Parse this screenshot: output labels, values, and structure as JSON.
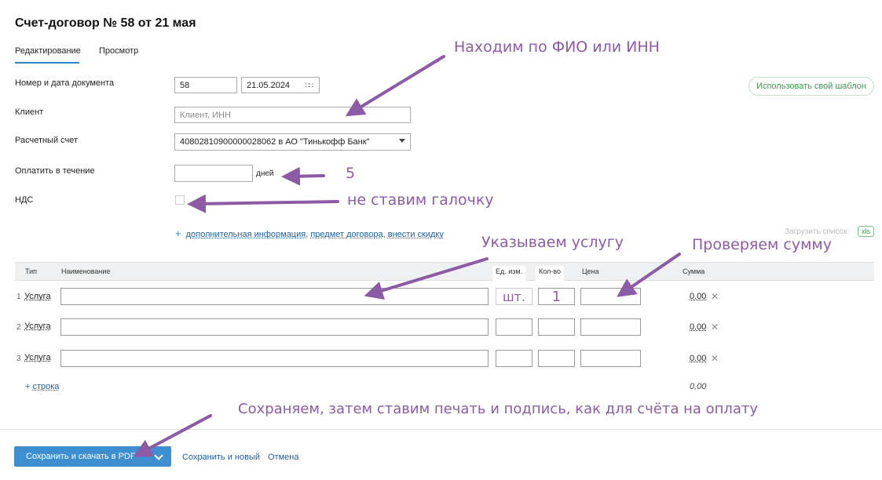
{
  "page": {
    "title": "Счет-договор № 58 от 21 мая",
    "tabs": [
      {
        "label": "Редактирование",
        "active": true
      },
      {
        "label": "Просмотр",
        "active": false
      }
    ]
  },
  "form": {
    "doc_number_label": "Номер и дата документа",
    "doc_number": "58",
    "doc_date": "21.05.2024",
    "client_label": "Клиент",
    "client_placeholder": "Клиент, ИНН",
    "account_label": "Расчетный счет",
    "account_value": "40802810900000028062 в АО \"Тинькофф Банк\"",
    "pay_within_label": "Оплатить в течение",
    "pay_within_value": "",
    "pay_within_unit": "дней",
    "vat_label": "НДС",
    "vat_checked": false,
    "more_info": {
      "part1": "дополнительная информация",
      "sep1": ",",
      "part2": "предмет договора",
      "sep2": ",",
      "part3": "внести скидку"
    },
    "template_button": "Использовать свой шаблон",
    "load_list": "Загрузить список:",
    "xls_label": "xls"
  },
  "table": {
    "headers": {
      "type": "Тип",
      "name": "Наименование",
      "unit": "Ед. изм.",
      "qty": "Кол-во",
      "price": "Цена",
      "sum": "Сумма"
    },
    "rows": [
      {
        "num": "1",
        "type": "Услуга",
        "name": "",
        "unit": "шт.",
        "qty": "1",
        "price": "",
        "sum": "0.00"
      },
      {
        "num": "2",
        "type": "Услуга",
        "name": "",
        "unit": "",
        "qty": "",
        "price": "",
        "sum": "0.00"
      },
      {
        "num": "3",
        "type": "Услуга",
        "name": "",
        "unit": "",
        "qty": "",
        "price": "",
        "sum": "0.00"
      }
    ],
    "add_row": "строка",
    "total": "0,00"
  },
  "footer": {
    "save_pdf": "Сохранить и скачать в PDF",
    "save_new": "Сохранить и новый",
    "cancel": "Отмена"
  },
  "annotations": {
    "find": "Находим по ФИО или ИНН",
    "days": "5",
    "no_check": "не ставим галочку",
    "service": "Указываем услугу",
    "check_sum": "Проверяем сумму",
    "save_note": "Сохраняем, затем ставим печать и подпись, как для счёта на оплату"
  },
  "colors": {
    "accent": "#3d8fd0",
    "link": "#1f5e9a",
    "annotation": "#8d5aa6",
    "template_green": "#3a9a4b"
  }
}
